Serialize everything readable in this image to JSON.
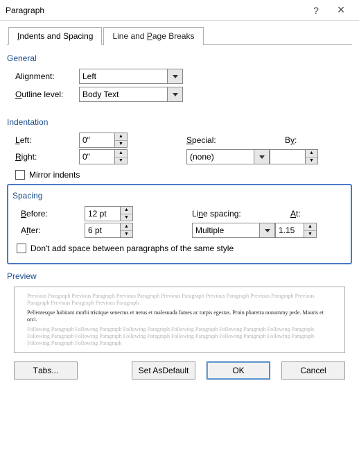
{
  "titlebar": {
    "title": "Paragraph",
    "help": "?",
    "close": "×"
  },
  "tabs": {
    "indents_spacing": "Indents and Spacing",
    "line_page_breaks": "Line and Page Breaks"
  },
  "general": {
    "heading": "General",
    "alignment_label": "Alignment:",
    "alignment_value": "Left",
    "outline_label": "Outline level:",
    "outline_value": "Body Text"
  },
  "indentation": {
    "heading": "Indentation",
    "left_label": "Left:",
    "left_value": "0\"",
    "right_label": "Right:",
    "right_value": "0\"",
    "special_label": "Special:",
    "special_value": "(none)",
    "by_label": "By:",
    "by_value": "",
    "mirror_label": "Mirror indents"
  },
  "spacing": {
    "heading": "Spacing",
    "before_label": "Before:",
    "before_value": "12 pt",
    "after_label": "After:",
    "after_value": "6 pt",
    "line_spacing_label": "Line spacing:",
    "line_spacing_value": "Multiple",
    "at_label": "At:",
    "at_value": "1.15",
    "noadd_label": "Don't add space between paragraphs of the same style"
  },
  "preview": {
    "heading": "Preview",
    "prev_text": "Previous Paragraph Previous Paragraph Previous Paragraph Previous Paragraph Previous Paragraph Previous Paragraph Previous Paragraph Previous Paragraph Previous Paragraph",
    "sample_text": "Pellentesque habitant morbi tristique senectus et netus et malesuada fames ac turpis egestas. Proin pharetra nonummy pede. Mauris et orci.",
    "next_text": "Following Paragraph Following Paragraph Following Paragraph Following Paragraph Following Paragraph Following Paragraph Following Paragraph Following Paragraph Following Paragraph Following Paragraph Following Paragraph Following Paragraph Following Paragraph Following Paragraph"
  },
  "buttons": {
    "tabs": "Tabs...",
    "set_default": "Set As Default",
    "ok": "OK",
    "cancel": "Cancel"
  }
}
